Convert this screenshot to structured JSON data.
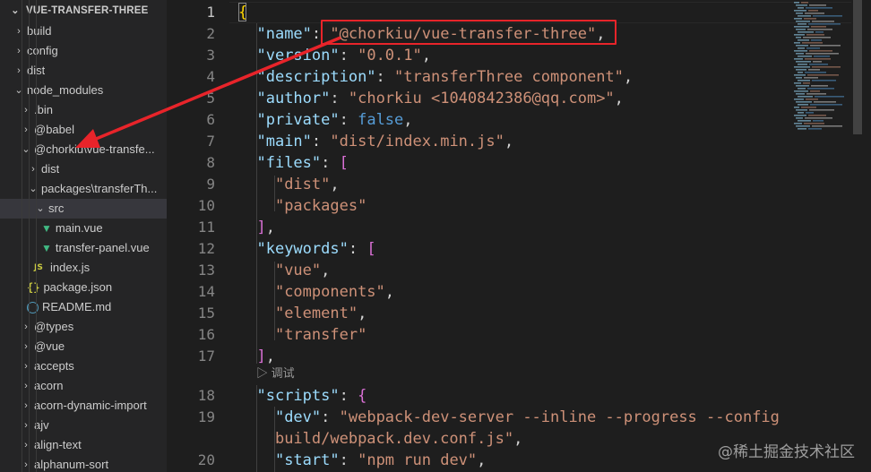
{
  "explorer": {
    "title": "VUE-TRANSFER-THREE",
    "items": [
      {
        "label": "build",
        "indent": 1,
        "kind": "folder",
        "open": false
      },
      {
        "label": "config",
        "indent": 1,
        "kind": "folder",
        "open": false
      },
      {
        "label": "dist",
        "indent": 1,
        "kind": "folder",
        "open": false
      },
      {
        "label": "node_modules",
        "indent": 1,
        "kind": "folder",
        "open": true
      },
      {
        "label": ".bin",
        "indent": 2,
        "kind": "folder",
        "open": false
      },
      {
        "label": "@babel",
        "indent": 2,
        "kind": "folder",
        "open": false
      },
      {
        "label": "@chorkiu\\vue-transfe...",
        "indent": 2,
        "kind": "folder",
        "open": true
      },
      {
        "label": "dist",
        "indent": 3,
        "kind": "folder",
        "open": false
      },
      {
        "label": "packages\\transferTh...",
        "indent": 3,
        "kind": "folder",
        "open": true
      },
      {
        "label": "src",
        "indent": 4,
        "kind": "folder",
        "open": true,
        "selected": true
      },
      {
        "label": "main.vue",
        "indent": 5,
        "kind": "vue"
      },
      {
        "label": "transfer-panel.vue",
        "indent": 5,
        "kind": "vue"
      },
      {
        "label": "index.js",
        "indent": 4,
        "kind": "js"
      },
      {
        "label": "package.json",
        "indent": 3,
        "kind": "json"
      },
      {
        "label": "README.md",
        "indent": 3,
        "kind": "info"
      },
      {
        "label": "@types",
        "indent": 2,
        "kind": "folder",
        "open": false
      },
      {
        "label": "@vue",
        "indent": 2,
        "kind": "folder",
        "open": false
      },
      {
        "label": "accepts",
        "indent": 2,
        "kind": "folder",
        "open": false
      },
      {
        "label": "acorn",
        "indent": 2,
        "kind": "folder",
        "open": false
      },
      {
        "label": "acorn-dynamic-import",
        "indent": 2,
        "kind": "folder",
        "open": false
      },
      {
        "label": "ajv",
        "indent": 2,
        "kind": "folder",
        "open": false
      },
      {
        "label": "align-text",
        "indent": 2,
        "kind": "folder",
        "open": false
      },
      {
        "label": "alphanum-sort",
        "indent": 2,
        "kind": "folder",
        "open": false
      }
    ]
  },
  "editor": {
    "codelens": "▷ 调试",
    "lines": [
      {
        "num": "1",
        "tokens": [
          [
            "br1",
            "{"
          ]
        ]
      },
      {
        "num": "2",
        "tokens": [
          [
            "p",
            "  "
          ],
          [
            "k",
            "\"name\""
          ],
          [
            "p",
            ": "
          ],
          [
            "s",
            "\"@chorkiu/vue-transfer-three\""
          ],
          [
            "p",
            ","
          ]
        ]
      },
      {
        "num": "3",
        "tokens": [
          [
            "p",
            "  "
          ],
          [
            "k",
            "\"version\""
          ],
          [
            "p",
            ": "
          ],
          [
            "s",
            "\"0.0.1\""
          ],
          [
            "p",
            ","
          ]
        ]
      },
      {
        "num": "4",
        "tokens": [
          [
            "p",
            "  "
          ],
          [
            "k",
            "\"description\""
          ],
          [
            "p",
            ": "
          ],
          [
            "s",
            "\"transferThree component\""
          ],
          [
            "p",
            ","
          ]
        ]
      },
      {
        "num": "5",
        "tokens": [
          [
            "p",
            "  "
          ],
          [
            "k",
            "\"author\""
          ],
          [
            "p",
            ": "
          ],
          [
            "s",
            "\"chorkiu <1040842386@qq.com>\""
          ],
          [
            "p",
            ","
          ]
        ]
      },
      {
        "num": "6",
        "tokens": [
          [
            "p",
            "  "
          ],
          [
            "k",
            "\"private\""
          ],
          [
            "p",
            ": "
          ],
          [
            "b",
            "false"
          ],
          [
            "p",
            ","
          ]
        ]
      },
      {
        "num": "7",
        "tokens": [
          [
            "p",
            "  "
          ],
          [
            "k",
            "\"main\""
          ],
          [
            "p",
            ": "
          ],
          [
            "s",
            "\"dist/index.min.js\""
          ],
          [
            "p",
            ","
          ]
        ]
      },
      {
        "num": "8",
        "tokens": [
          [
            "p",
            "  "
          ],
          [
            "k",
            "\"files\""
          ],
          [
            "p",
            ": "
          ],
          [
            "br",
            "["
          ]
        ]
      },
      {
        "num": "9",
        "tokens": [
          [
            "p",
            "    "
          ],
          [
            "s",
            "\"dist\""
          ],
          [
            "p",
            ","
          ]
        ]
      },
      {
        "num": "10",
        "tokens": [
          [
            "p",
            "    "
          ],
          [
            "s",
            "\"packages\""
          ]
        ]
      },
      {
        "num": "11",
        "tokens": [
          [
            "p",
            "  "
          ],
          [
            "br",
            "]"
          ],
          [
            "p",
            ","
          ]
        ]
      },
      {
        "num": "12",
        "tokens": [
          [
            "p",
            "  "
          ],
          [
            "k",
            "\"keywords\""
          ],
          [
            "p",
            ": "
          ],
          [
            "br",
            "["
          ]
        ]
      },
      {
        "num": "13",
        "tokens": [
          [
            "p",
            "    "
          ],
          [
            "s",
            "\"vue\""
          ],
          [
            "p",
            ","
          ]
        ]
      },
      {
        "num": "14",
        "tokens": [
          [
            "p",
            "    "
          ],
          [
            "s",
            "\"components\""
          ],
          [
            "p",
            ","
          ]
        ]
      },
      {
        "num": "15",
        "tokens": [
          [
            "p",
            "    "
          ],
          [
            "s",
            "\"element\""
          ],
          [
            "p",
            ","
          ]
        ]
      },
      {
        "num": "16",
        "tokens": [
          [
            "p",
            "    "
          ],
          [
            "s",
            "\"transfer\""
          ]
        ]
      },
      {
        "num": "17",
        "tokens": [
          [
            "p",
            "  "
          ],
          [
            "br",
            "]"
          ],
          [
            "p",
            ","
          ]
        ]
      },
      {
        "num": "18",
        "tokens": [
          [
            "p",
            "  "
          ],
          [
            "k",
            "\"scripts\""
          ],
          [
            "p",
            ": "
          ],
          [
            "br",
            "{"
          ]
        ]
      },
      {
        "num": "19",
        "tokens": [
          [
            "p",
            "    "
          ],
          [
            "k",
            "\"dev\""
          ],
          [
            "p",
            ": "
          ],
          [
            "s",
            "\"webpack-dev-server --inline --progress --config"
          ]
        ]
      },
      {
        "num": "",
        "tokens": [
          [
            "p",
            "    "
          ],
          [
            "s",
            "build/webpack.dev.conf.js\""
          ],
          [
            "p",
            ","
          ]
        ]
      },
      {
        "num": "20",
        "tokens": [
          [
            "p",
            "    "
          ],
          [
            "k",
            "\"start\""
          ],
          [
            "p",
            ": "
          ],
          [
            "s",
            "\"npm run dev\""
          ],
          [
            "p",
            ","
          ]
        ]
      }
    ]
  },
  "watermark": "@稀土掘金技术社区",
  "colors": {
    "annotation": "#e8242a",
    "sidebar_bg": "#252526",
    "editor_bg": "#1e1e1e"
  }
}
